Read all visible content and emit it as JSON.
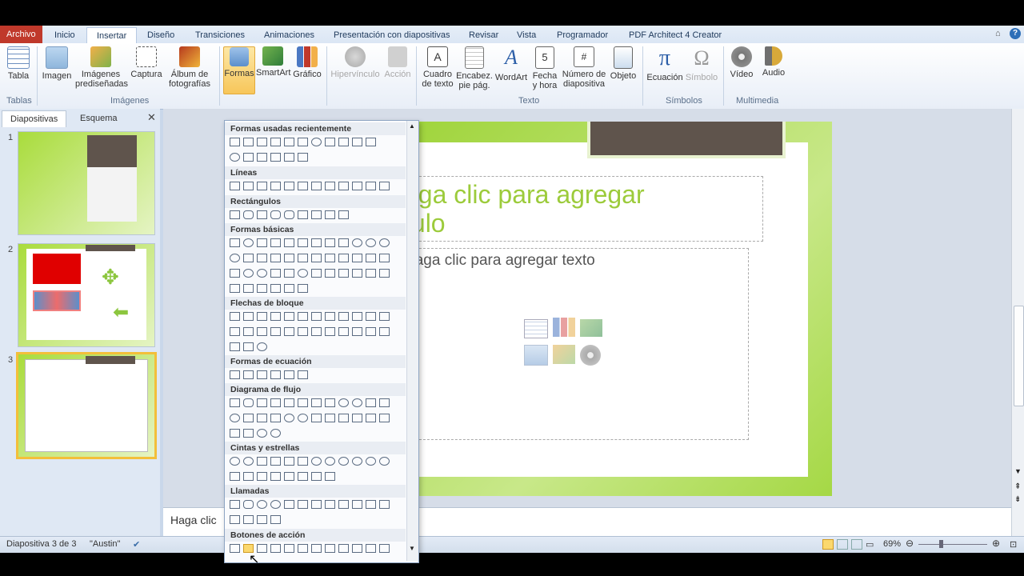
{
  "tabs": [
    "Archivo",
    "Inicio",
    "Insertar",
    "Diseño",
    "Transiciones",
    "Animaciones",
    "Presentación con diapositivas",
    "Revisar",
    "Vista",
    "Programador",
    "PDF Architect 4 Creator"
  ],
  "active_tab": "Insertar",
  "ribbon": {
    "tablas_group": "Tablas",
    "imagenes_group": "Imágenes",
    "texto_group": "Texto",
    "simbolos_group": "Símbolos",
    "multimedia_group": "Multimedia",
    "buttons": {
      "tabla": "Tabla",
      "imagen": "Imagen",
      "imagenes_pred_1": "Imágenes",
      "imagenes_pred_2": "prediseñadas",
      "captura": "Captura",
      "album_1": "Álbum de",
      "album_2": "fotografías",
      "formas": "Formas",
      "smartart": "SmartArt",
      "grafico": "Gráfico",
      "hipervinculo": "Hipervínculo",
      "accion": "Acción",
      "cuadro_1": "Cuadro",
      "cuadro_2": "de texto",
      "encabez_1": "Encabez.",
      "encabez_2": "pie pág.",
      "wordart": "WordArt",
      "fecha_1": "Fecha",
      "fecha_2": "y hora",
      "numero_1": "Número de",
      "numero_2": "diapositiva",
      "objeto": "Objeto",
      "ecuacion": "Ecuación",
      "simbolo": "Símbolo",
      "video": "Vídeo",
      "audio": "Audio"
    }
  },
  "left_panel": {
    "tab_slides": "Diapositivas",
    "tab_outline": "Esquema",
    "slide_numbers": [
      "1",
      "2",
      "3"
    ]
  },
  "slide": {
    "title_placeholder": "Haga clic para agregar título",
    "title_visible_line1": "aga clic para agregar",
    "title_visible_line2": "tulo",
    "body_placeholder": "Haga clic para agregar texto"
  },
  "notes_placeholder": "Haga clic",
  "shapes_menu": {
    "sections": [
      "Formas usadas recientemente",
      "Líneas",
      "Rectángulos",
      "Formas básicas",
      "Flechas de bloque",
      "Formas de ecuación",
      "Diagrama de flujo",
      "Cintas y estrellas",
      "Llamadas",
      "Botones de acción"
    ]
  },
  "status": {
    "slide_info": "Diapositiva 3 de 3",
    "theme": "\"Austin\"",
    "zoom": "69%"
  },
  "colors": {
    "file_tab": "#c0392b",
    "slide_green": "#9fd43a",
    "title_text": "#9ccb3b",
    "dark_block": "#5f544c"
  }
}
